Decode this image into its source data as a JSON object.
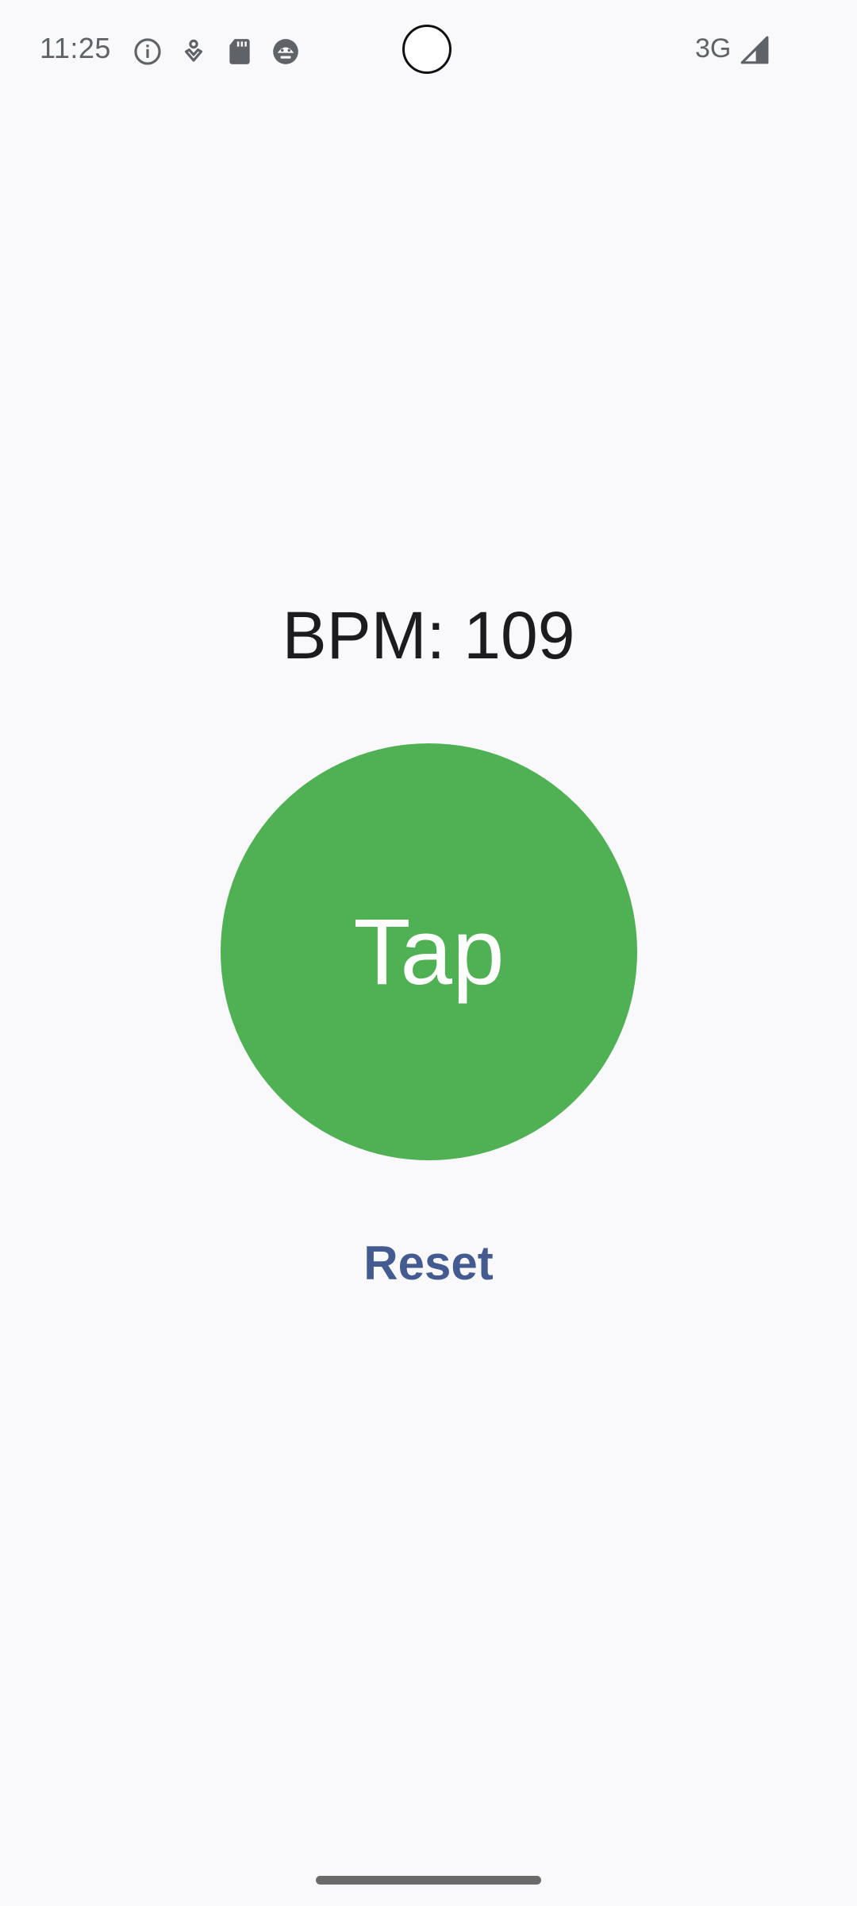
{
  "status_bar": {
    "time": "11:25",
    "icons": [
      "info-icon",
      "location-pin-icon",
      "sd-card-icon",
      "android-face-icon"
    ],
    "network_type": "3G",
    "signal_icon": "signal-strength-icon"
  },
  "main": {
    "bpm_text": "BPM: 109",
    "tap_label": "Tap",
    "reset_label": "Reset"
  },
  "colors": {
    "background": "#f9f9fc",
    "tap_button": "#4fb153",
    "reset_text": "#435b91",
    "bpm_text": "#1c1b1f"
  }
}
